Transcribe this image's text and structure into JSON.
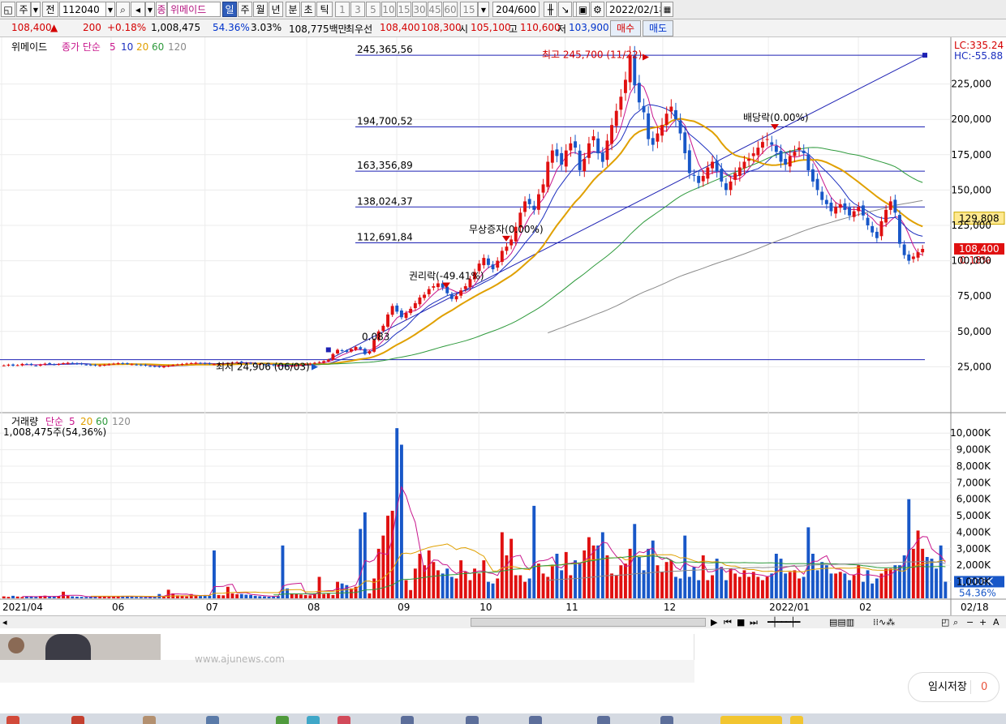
{
  "toolbar": {
    "period_label": "주",
    "prev_label": "전",
    "code_value": "112040",
    "stock_tag": "종",
    "stock_name": "위메이드",
    "intervals": [
      "일",
      "주",
      "월",
      "년",
      "분",
      "초",
      "틱"
    ],
    "tick_values": [
      "1",
      "3",
      "5",
      "10",
      "15",
      "30",
      "45",
      "60",
      "15"
    ],
    "count_value": "204",
    "count_total": "/600",
    "date_value": "2022/02/18"
  },
  "info": {
    "price": "108,400",
    "change": "200",
    "change_pct": "+0.18%",
    "volume": "1,008,475",
    "volume_ratio": "54.36%",
    "turnover": "3.03%",
    "amount": "108,775백만",
    "best_label": "최우선",
    "best_ask": "108,400",
    "best_bid": "108,300",
    "open_label": "시",
    "open": "105,100",
    "high_label": "고",
    "high": "110,600",
    "low_label": "저",
    "low": "103,900",
    "buy_label": "매수",
    "sell_label": "매도"
  },
  "chart_data": {
    "type": "candlestick",
    "x_ticks": [
      "2021/04",
      "06",
      "07",
      "08",
      "09",
      "10",
      "11",
      "12",
      "2022/01",
      "02",
      "02/18"
    ],
    "price_panel": {
      "legend_name": "위메이드",
      "legend_ma_label": "종가 단순",
      "ma_periods": [
        "5",
        "10",
        "20",
        "60",
        "120"
      ],
      "ma_colors": [
        "#c8168c",
        "#1c2fbf",
        "#e0a000",
        "#2e9a3c",
        "#8a8a8a"
      ],
      "y_ticks": [
        25000,
        50000,
        75000,
        100000,
        125000,
        150000,
        175000,
        200000,
        225000
      ],
      "y_tick_labels": [
        "25,000",
        "50,000",
        "75,000",
        "100,000",
        "125,000",
        "150,000",
        "175,000",
        "200,000",
        "225,000"
      ],
      "ylim": [
        0,
        250000
      ],
      "lc_label": "LC:335.24",
      "hc_label": "HC:-55.88",
      "current_price_label": "108,400",
      "current_change_label": "0.18%",
      "ma_value_label": "129,808",
      "fib_levels": [
        {
          "value": 245365.56,
          "label": "245,365,56"
        },
        {
          "value": 194700.52,
          "label": "194,700,52"
        },
        {
          "value": 163356.89,
          "label": "163,356,89"
        },
        {
          "value": 138024.37,
          "label": "138,024,37"
        },
        {
          "value": 112691.84,
          "label": "112,691,84"
        },
        {
          "value": 30000,
          "label": ""
        }
      ],
      "annotations": [
        {
          "text": "최고 245,700 (11/22)",
          "value": 245700
        },
        {
          "text": "배당락(0.00%)",
          "value": 192000
        },
        {
          "text": "무상증자(0.00%)",
          "value": 113000
        },
        {
          "text": "권리락(-49.41%)",
          "value": 80000
        },
        {
          "text": "최저 24,906 (06/03)",
          "value": 24906
        },
        {
          "text": "0.083",
          "value": 37000
        }
      ],
      "closes": [
        26000,
        26500,
        25800,
        26200,
        27000,
        26800,
        26300,
        25900,
        26500,
        27200,
        27000,
        26600,
        26900,
        27500,
        27800,
        27400,
        27000,
        26800,
        26500,
        26200,
        25900,
        26100,
        26400,
        26800,
        27200,
        27600,
        27300,
        27000,
        26700,
        26400,
        26100,
        25800,
        25500,
        25200,
        24906,
        25400,
        25800,
        26200,
        26600,
        27000,
        27300,
        27600,
        27800,
        27500,
        27200,
        27000,
        26800,
        27000,
        27300,
        27600,
        27900,
        28200,
        28000,
        27700,
        27400,
        27100,
        26900,
        26600,
        26300,
        26000,
        25800,
        25600,
        25500,
        25800,
        26100,
        26500,
        26900,
        27300,
        27800,
        28300,
        29000,
        30000,
        34000,
        37000,
        36500,
        35500,
        37500,
        39000,
        37500,
        34000,
        36000,
        44000,
        50000,
        54000,
        62000,
        68000,
        64000,
        60000,
        63000,
        66000,
        70000,
        74000,
        76000,
        80000,
        82000,
        84000,
        81000,
        77000,
        73000,
        75000,
        79000,
        82000,
        87000,
        92000,
        98000,
        102000,
        97000,
        94000,
        100000,
        107000,
        110000,
        115000,
        124000,
        134000,
        142000,
        140000,
        136000,
        147000,
        154000,
        170000,
        178000,
        174000,
        168000,
        178000,
        183000,
        180000,
        164000,
        172000,
        183000,
        188000,
        176000,
        170000,
        185000,
        196000,
        206000,
        216000,
        228000,
        245700,
        224000,
        212000,
        205000,
        186000,
        182000,
        190000,
        196000,
        204000,
        209000,
        200000,
        190000,
        176000,
        162000,
        160000,
        155000,
        160000,
        166000,
        170000,
        163000,
        156000,
        150000,
        156000,
        162000,
        166000,
        170000,
        172000,
        176000,
        180000,
        184000,
        186000,
        182000,
        177000,
        170000,
        168000,
        174000,
        177000,
        180000,
        176000,
        164000,
        156000,
        150000,
        143000,
        140000,
        135000,
        138000,
        140000,
        136000,
        132000,
        135000,
        138000,
        132000,
        125000,
        120000,
        116000,
        128000,
        136000,
        142000,
        134000,
        112000,
        104000,
        100000,
        103000,
        106000,
        108400
      ]
    },
    "volume_panel": {
      "legend_name": "거래량",
      "legend_ma_label": "단순",
      "ma_periods": [
        "5",
        "20",
        "60",
        "120"
      ],
      "ma_colors": [
        "#c8168c",
        "#e0a000",
        "#2e9a3c",
        "#8a8a8a"
      ],
      "info_label": "1,008,475주(54,36%)",
      "current_label": "1,008K",
      "ratio_label": "54.36%",
      "y_tick_labels": [
        "1,000K",
        "2,000K",
        "3,000K",
        "4,000K",
        "5,000K",
        "6,000K",
        "7,000K",
        "8,000K",
        "9,000K",
        "10,000K"
      ],
      "ylim_k": [
        0,
        10500
      ],
      "volumes_k": [
        120,
        90,
        150,
        110,
        80,
        130,
        100,
        90,
        140,
        160,
        110,
        100,
        130,
        400,
        150,
        120,
        100,
        90,
        80,
        100,
        120,
        140,
        110,
        90,
        100,
        120,
        150,
        130,
        110,
        90,
        80,
        70,
        100,
        120,
        260,
        100,
        520,
        300,
        180,
        150,
        120,
        260,
        200,
        140,
        170,
        150,
        2900,
        200,
        180,
        700,
        300,
        250,
        260,
        220,
        200,
        150,
        130,
        120,
        100,
        110,
        140,
        3200,
        600,
        300,
        250,
        230,
        200,
        180,
        280,
        1300,
        260,
        300,
        200,
        1000,
        900,
        800,
        600,
        700,
        4200,
        5200,
        300,
        1200,
        3000,
        3800,
        5000,
        5300,
        10300,
        9300,
        1100,
        500,
        1800,
        2700,
        2000,
        2900,
        2200,
        1700,
        1500,
        1800,
        1300,
        1200,
        2300,
        1600,
        1100,
        1800,
        1500,
        2300,
        1000,
        900,
        1200,
        4000,
        2600,
        3600,
        1400,
        1400,
        1000,
        1200,
        5600,
        2100,
        1500,
        1300,
        2000,
        2700,
        1700,
        2800,
        1400,
        2300,
        2100,
        2900,
        3700,
        3200,
        3200,
        4000,
        2600,
        1500,
        1400,
        2000,
        2100,
        3000,
        4500,
        2500,
        1700,
        3000,
        3500,
        2000,
        1600,
        2200,
        2300,
        1300,
        1200,
        3800,
        1300,
        1900,
        1100,
        2600,
        1100,
        1400,
        2400,
        1900,
        1100,
        1800,
        1500,
        1300,
        1700,
        1300,
        1600,
        1300,
        1100,
        1300,
        1500,
        2700,
        2400,
        1500,
        1600,
        1700,
        1200,
        1300,
        4300,
        2700,
        1700,
        2200,
        2000,
        1500,
        1500,
        1600,
        1500,
        1100,
        1400,
        2000,
        1000,
        1700,
        900,
        1200,
        1500,
        1800,
        1800,
        2000,
        2000,
        2600,
        6000,
        3000,
        4100,
        3000,
        2500,
        2400,
        1800,
        3200,
        1008
      ]
    }
  },
  "scroll": {
    "icons": [
      "play-icon",
      "prev-icon",
      "stop-icon",
      "next-icon"
    ]
  },
  "page": {
    "url_text": "www.ajunews.com",
    "save_label": "임시저장",
    "save_count": "0"
  }
}
